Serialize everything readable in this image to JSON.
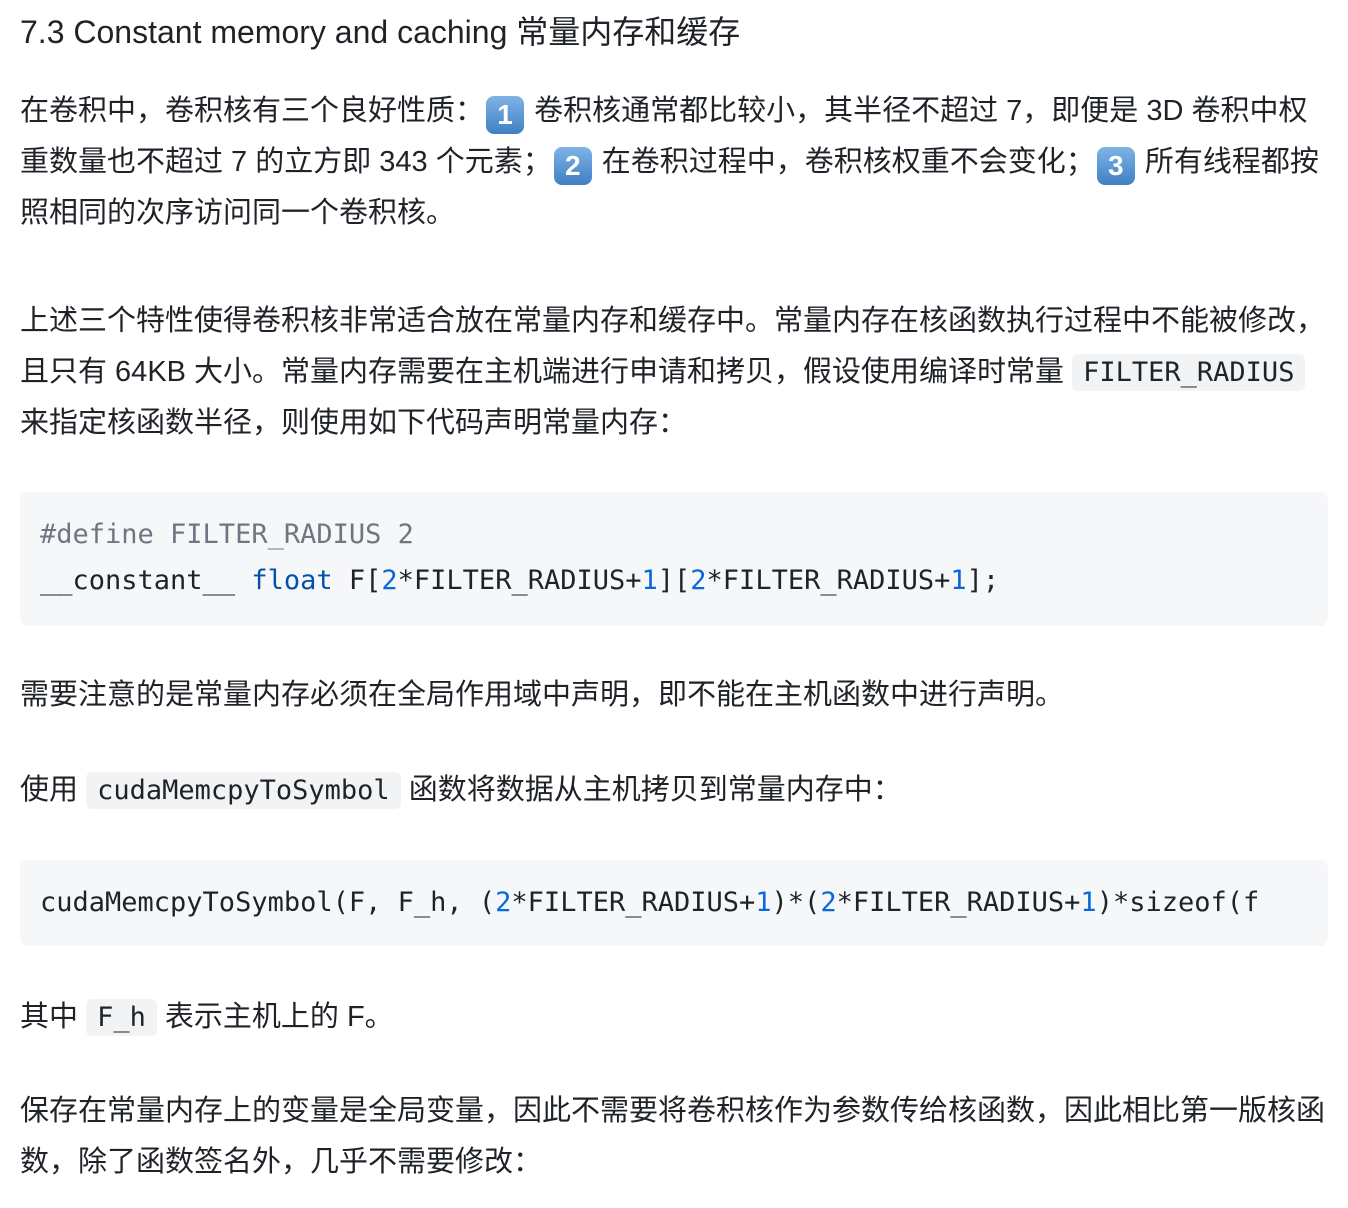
{
  "heading": "7.3 Constant memory and caching 常量内存和缓存",
  "p1": {
    "intro": "在卷积中，卷积核有三个良好性质：",
    "badge1": "1",
    "item1": " 卷积核通常都比较小，其半径不超过 7，即便是 3D 卷积中权重数量也不超过 7 的立方即 343 个元素；",
    "badge2": "2",
    "item2": " 在卷积过程中，卷积核权重不会变化；",
    "badge3": "3",
    "item3": " 所有线程都按照相同的次序访问同一个卷积核。"
  },
  "p2": {
    "text_before": "上述三个特性使得卷积核非常适合放在常量内存和缓存中。常量内存在核函数执行过程中不能被修改，且只有 64KB 大小。常量内存需要在主机端进行申请和拷贝，假设使用编译时常量",
    "code": "FILTER_RADIUS",
    "text_after": " 来指定核函数半径，则使用如下代码声明常量内存："
  },
  "code1": {
    "line1": "#define FILTER_RADIUS 2",
    "line2_prefix": "__constant__ ",
    "line2_kw": "float",
    "line2_a": " F[",
    "n1": "2",
    "line2_b": "*FILTER_RADIUS+",
    "n2": "1",
    "line2_c": "][",
    "n3": "2",
    "line2_d": "*FILTER_RADIUS+",
    "n4": "1",
    "line2_e": "];"
  },
  "p3": "需要注意的是常量内存必须在全局作用域中声明，即不能在主机函数中进行声明。",
  "p4": {
    "before": "使用 ",
    "code": "cudaMemcpyToSymbol",
    "after": " 函数将数据从主机拷贝到常量内存中："
  },
  "code2": {
    "a": "cudaMemcpyToSymbol(F, F_h, (",
    "n1": "2",
    "b": "*FILTER_RADIUS+",
    "n2": "1",
    "c": ")*(",
    "n3": "2",
    "d": "*FILTER_RADIUS+",
    "n4": "1",
    "e": ")*sizeof(f"
  },
  "p5": {
    "before": "其中 ",
    "code": "F_h",
    "after": " 表示主机上的 F。"
  },
  "p6": "保存在常量内存上的变量是全局变量，因此不需要将卷积核作为参数传给核函数，因此相比第一版核函数，除了函数签名外，几乎不需要修改："
}
